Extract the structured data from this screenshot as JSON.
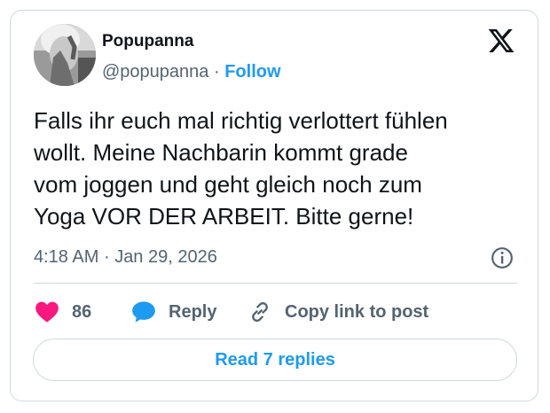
{
  "user": {
    "display_name": "Popupanna",
    "handle": "@popupanna",
    "separator": "·",
    "follow_label": "Follow"
  },
  "tweet": {
    "text": "Falls ihr euch mal richtig verlottert fühlen\nwollt. Meine Nachbarin kommt grade\nvom joggen und geht gleich noch zum\nYoga VOR DER ARBEIT. Bitte gerne!",
    "time": "4:18 AM",
    "date_separator": "·",
    "date": "Jan 29, 2026"
  },
  "actions": {
    "like_count": "86",
    "reply_label": "Reply",
    "copy_link_label": "Copy link to post"
  },
  "replies_button_label": "Read 7 replies",
  "colors": {
    "accent": "#1d9bf0",
    "like": "#f91880",
    "text": "#0f1419",
    "secondary": "#536471",
    "border": "#cfd9de"
  },
  "icons": [
    "x-logo-icon",
    "info-icon",
    "heart-icon",
    "speech-bubble-icon",
    "link-icon"
  ]
}
